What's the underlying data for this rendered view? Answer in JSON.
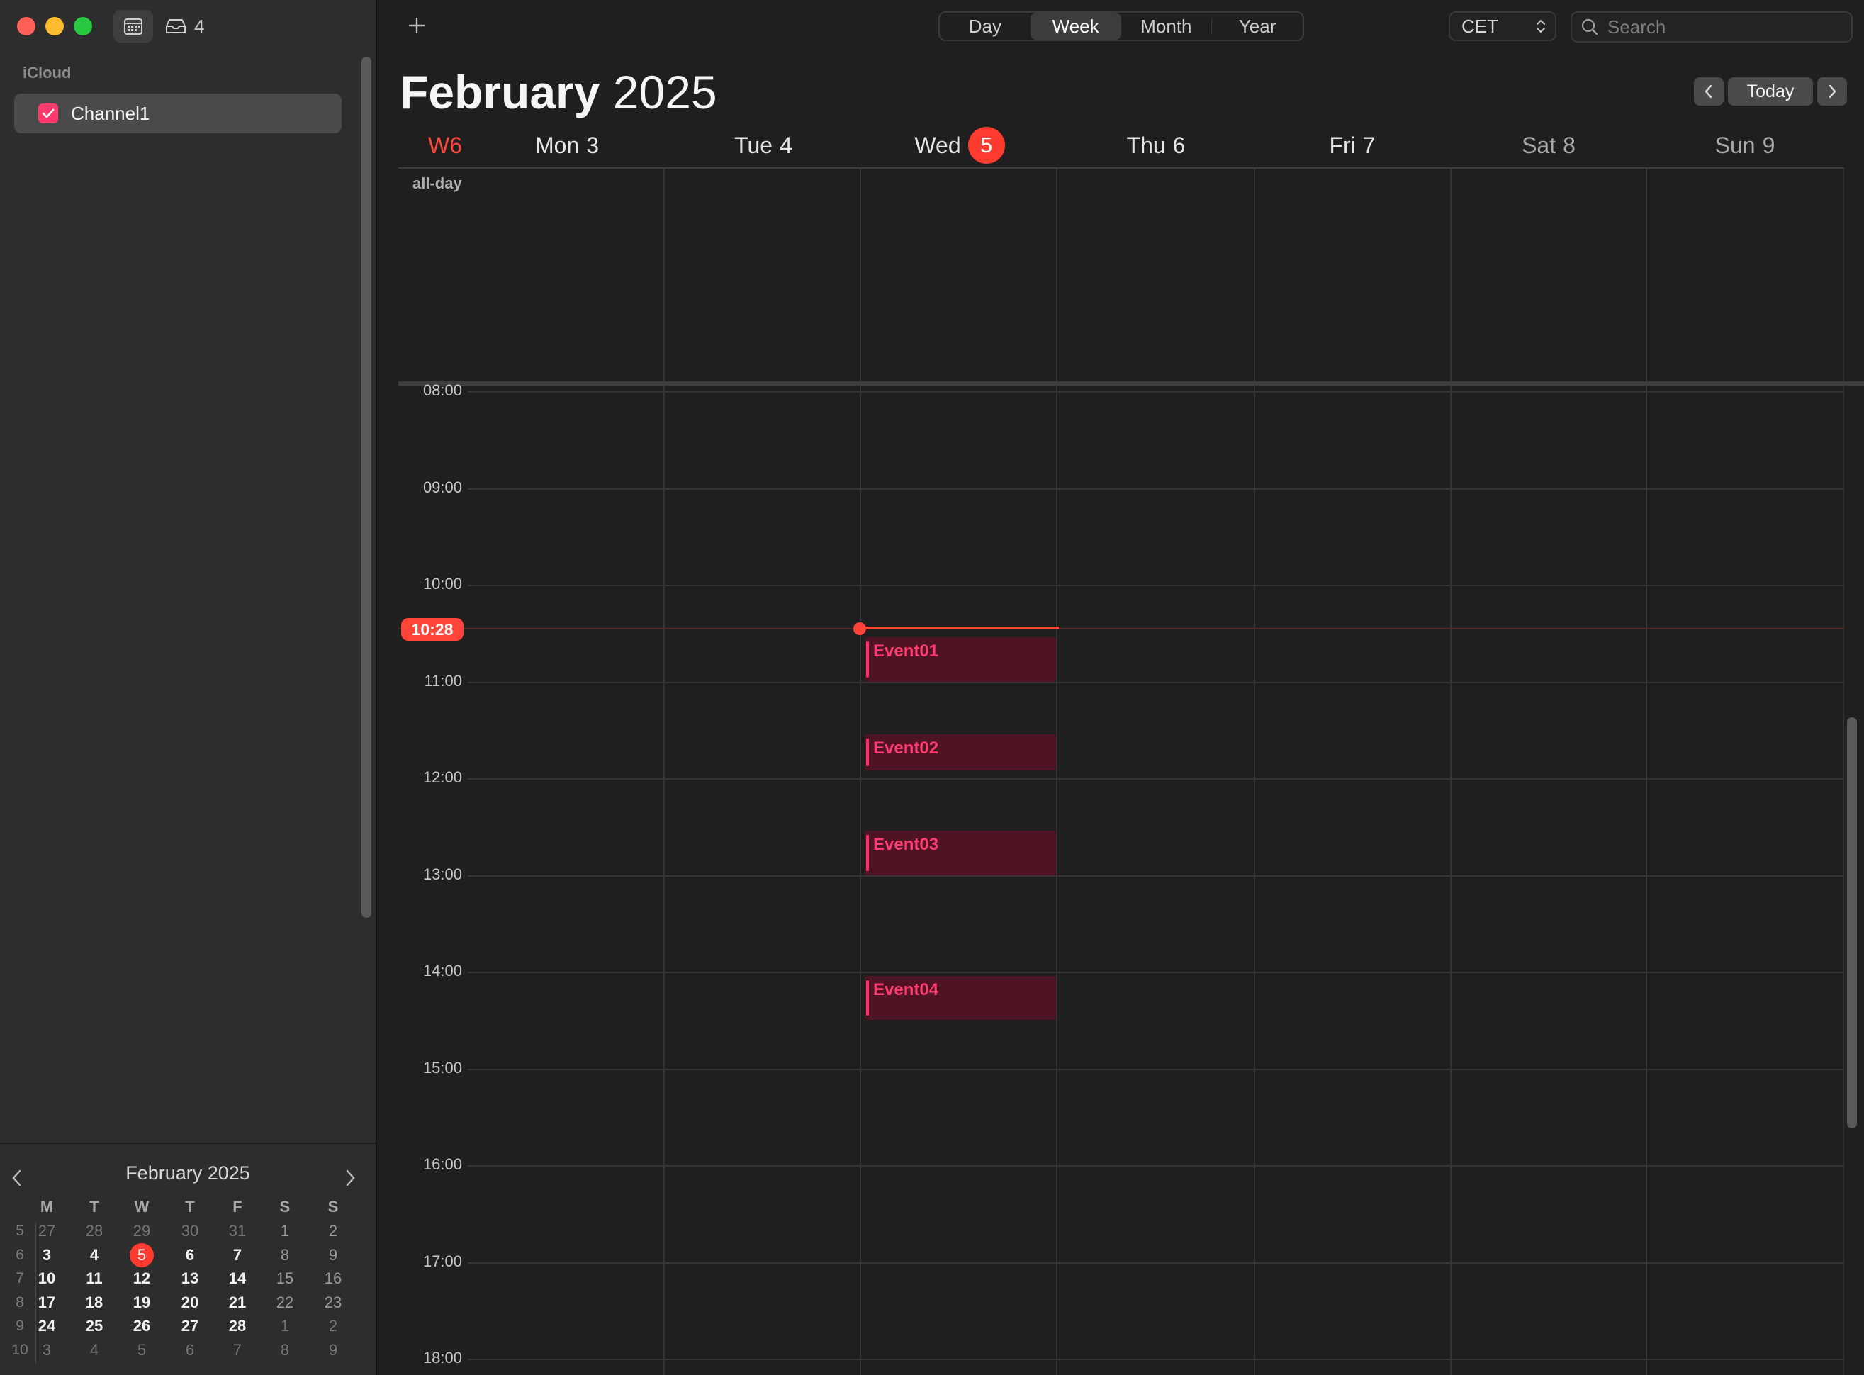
{
  "toolbar": {
    "inbox_count": "4",
    "view_tabs": [
      "Day",
      "Week",
      "Month",
      "Year"
    ],
    "active_view": "Week",
    "timezone": "CET",
    "search_placeholder": "Search",
    "today_label": "Today"
  },
  "sidebar": {
    "section_label": "iCloud",
    "calendars": [
      {
        "label": "Channel1",
        "checked": true,
        "color": "#ff3b6e"
      }
    ]
  },
  "mini_calendar": {
    "title": "February 2025",
    "weekday_headers": [
      "M",
      "T",
      "W",
      "T",
      "F",
      "S",
      "S"
    ],
    "weeks": [
      {
        "num": "5",
        "days": [
          "27",
          "28",
          "29",
          "30",
          "31",
          "1",
          "2"
        ]
      },
      {
        "num": "6",
        "days": [
          "3",
          "4",
          "5",
          "6",
          "7",
          "8",
          "9"
        ]
      },
      {
        "num": "7",
        "days": [
          "10",
          "11",
          "12",
          "13",
          "14",
          "15",
          "16"
        ]
      },
      {
        "num": "8",
        "days": [
          "17",
          "18",
          "19",
          "20",
          "21",
          "22",
          "23"
        ]
      },
      {
        "num": "9",
        "days": [
          "24",
          "25",
          "26",
          "27",
          "28",
          "1",
          "2"
        ]
      },
      {
        "num": "10",
        "days": [
          "3",
          "4",
          "5",
          "6",
          "7",
          "8",
          "9"
        ]
      }
    ],
    "today": "5"
  },
  "header": {
    "month": "February",
    "year": "2025",
    "week_label": "W6",
    "days": [
      {
        "name": "Mon",
        "num": "3"
      },
      {
        "name": "Tue",
        "num": "4"
      },
      {
        "name": "Wed",
        "num": "5"
      },
      {
        "name": "Thu",
        "num": "6"
      },
      {
        "name": "Fri",
        "num": "7"
      },
      {
        "name": "Sat",
        "num": "8"
      },
      {
        "name": "Sun",
        "num": "9"
      }
    ],
    "today_index": 2
  },
  "grid": {
    "allday_label": "all-day",
    "hours": [
      "08:00",
      "09:00",
      "10:00",
      "11:00",
      "12:00",
      "13:00",
      "14:00",
      "15:00",
      "16:00",
      "17:00",
      "18:00"
    ],
    "now": "10:28"
  },
  "events": [
    {
      "title": "Event01",
      "start": "10:30",
      "end": "11:00"
    },
    {
      "title": "Event02",
      "start": "11:30",
      "end": "11:55"
    },
    {
      "title": "Event03",
      "start": "12:30",
      "end": "13:00"
    },
    {
      "title": "Event04",
      "start": "14:00",
      "end": "14:30"
    }
  ],
  "colors": {
    "accent": "#ff453a",
    "event_bg": "#4e1424",
    "event_text": "#ff3b72"
  }
}
